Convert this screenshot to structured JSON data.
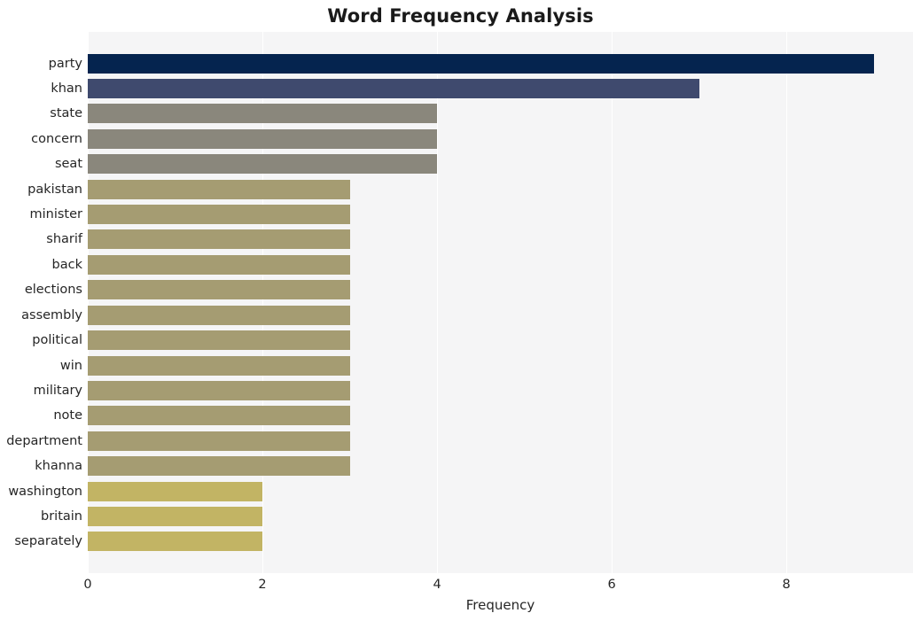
{
  "chart_data": {
    "type": "bar",
    "orientation": "horizontal",
    "title": "Word Frequency Analysis",
    "xlabel": "Frequency",
    "ylabel": "",
    "xlim": [
      0,
      9.45
    ],
    "ylim": [
      0,
      20
    ],
    "grid": true,
    "legend": false,
    "xticks": [
      "0",
      "2",
      "4",
      "6",
      "8"
    ],
    "xtick_values": [
      0,
      2,
      4,
      6,
      8
    ],
    "categories": [
      "party",
      "khan",
      "state",
      "concern",
      "seat",
      "pakistan",
      "minister",
      "sharif",
      "back",
      "elections",
      "assembly",
      "political",
      "win",
      "military",
      "note",
      "department",
      "khanna",
      "washington",
      "britain",
      "separately"
    ],
    "values": [
      9,
      7,
      4,
      4,
      4,
      3,
      3,
      3,
      3,
      3,
      3,
      3,
      3,
      3,
      3,
      3,
      3,
      2,
      2,
      2
    ],
    "bar_colors": [
      "#05244f",
      "#3f4a6e",
      "#8a877c",
      "#8a877c",
      "#8a877c",
      "#a59c72",
      "#a59c72",
      "#a59c72",
      "#a59c72",
      "#a59c72",
      "#a59c72",
      "#a59c72",
      "#a59c72",
      "#a59c72",
      "#a59c72",
      "#a59c72",
      "#a59c72",
      "#c2b464",
      "#c2b464",
      "#c2b464"
    ],
    "plot_background": "#f5f5f6",
    "grid_color": "#ffffff",
    "figure_background": "#ffffff",
    "text_color": "#262626",
    "title_color": "#1a1a1a"
  }
}
